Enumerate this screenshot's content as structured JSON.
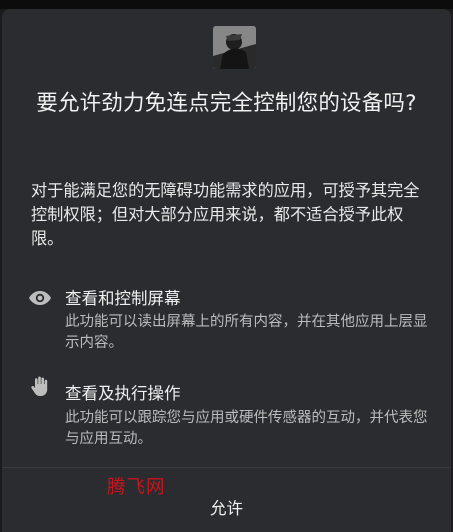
{
  "dialog": {
    "title": "要允许劲力免连点完全控制您的设备吗?",
    "description": "对于能满足您的无障碍功能需求的应用，可授予其完全控制权限；但对大部分应用来说，都不适合授予此权限。",
    "permissions": [
      {
        "icon": "eye-icon",
        "title": "查看和控制屏幕",
        "description": "此功能可以读出屏幕上的所有内容，并在其他应用上层显示内容。"
      },
      {
        "icon": "hand-icon",
        "title": "查看及执行操作",
        "description": "此功能可以跟踪您与应用或硬件传感器的互动，并代表您与应用互动。"
      }
    ],
    "allow_label": "允许"
  },
  "watermark": "腾飞网",
  "colors": {
    "dialog_background": "#2b2c2f",
    "screen_background": "#1b1b1d",
    "watermark": "#c8141c"
  }
}
